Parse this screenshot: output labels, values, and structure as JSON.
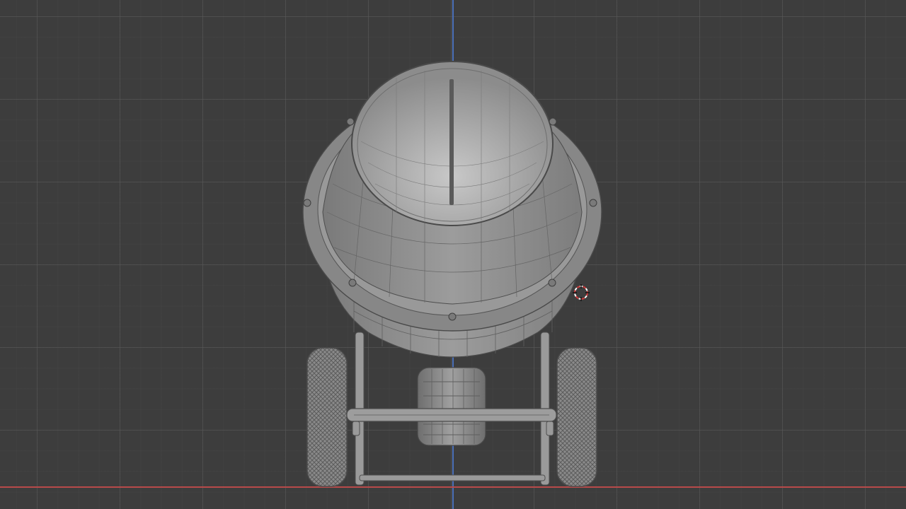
{
  "viewport": {
    "grid": true,
    "background_color": "#3d3d3d",
    "grid_color": "#5a5a5a",
    "axis_y_color": "#4a6fb8",
    "axis_x_color": "#b84a4a",
    "shading": "solid",
    "overlay": "wireframe"
  },
  "scene": {
    "object": "concrete-mixer",
    "parts": [
      "drum",
      "drum-rim",
      "drum-opening",
      "mixing-blade",
      "rim-bolts",
      "frame",
      "axle",
      "wheels",
      "motor"
    ],
    "mesh_color": "#8e8e8e",
    "wire_color": "#5b5b5b"
  },
  "cursor": {
    "icon": "3d-cursor-icon",
    "colors": [
      "#d33a3a",
      "#ffffff"
    ]
  }
}
